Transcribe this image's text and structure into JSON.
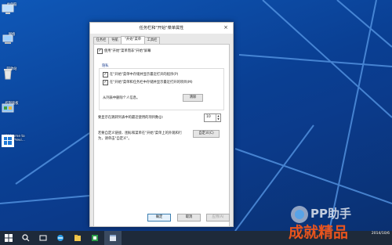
{
  "desktop": {
    "icons": [
      {
        "label": "此电脑",
        "icon": "computer-icon"
      },
      {
        "label": "网络",
        "icon": "network-icon"
      },
      {
        "label": "回收站",
        "icon": "recycle-bin-icon"
      },
      {
        "label": "控制面板",
        "icon": "control-panel-icon"
      },
      {
        "label": "Welcome to Tech Previ...",
        "icon": "welcome-icon"
      }
    ]
  },
  "dialog": {
    "title": "任务栏和\"开始\"菜单属性",
    "close": "×",
    "tabs": [
      "任务栏",
      "导航",
      "\"开始\"菜单",
      "工具栏"
    ],
    "active_tab": 2,
    "use_start_menu_label": "使用\"开始\"菜单而非\"开始\"屏幕",
    "use_start_menu_checked": true,
    "privacy": {
      "heading": "隐私",
      "store_programs_label": "在\"开始\"菜单中存储并显示最近打开的程序(P)",
      "store_programs_checked": true,
      "store_items_label": "在\"开始\"菜单和任务栏中存储并显示最近打开的项目(M)",
      "store_items_checked": true,
      "clear_hint": "从列表中删除个人信息。",
      "clear_button": "清除"
    },
    "jump_list_label": "要显示在跳转列表中的最近使用的项目数(J):",
    "jump_list_value": "10",
    "customize_hint_line1": "若要自定义链接、图标和菜单在\"开始\"菜单上的外观和行",
    "customize_hint_line2": "为，请单击\"自定义\"。",
    "customize_button": "自定义(C)",
    "ok_button": "确定",
    "cancel_button": "取消",
    "apply_button": "应用(A)"
  },
  "taskbar": {
    "items": [
      {
        "icon": "start-icon"
      },
      {
        "icon": "search-icon"
      },
      {
        "icon": "task-view-icon"
      },
      {
        "icon": "ie-icon"
      },
      {
        "icon": "file-explorer-icon"
      },
      {
        "icon": "store-icon"
      },
      {
        "icon": "window-icon"
      }
    ],
    "clock_line1": "",
    "clock_line2": "2014/10/6"
  },
  "watermark": {
    "line1": "PP助手",
    "line2": "成就精品"
  },
  "colors": {
    "desktop_bg": "#0b3f91",
    "taskbar_bg": "#1e2a3a",
    "accent": "#3c7fb1",
    "watermark": "#e8541e"
  }
}
